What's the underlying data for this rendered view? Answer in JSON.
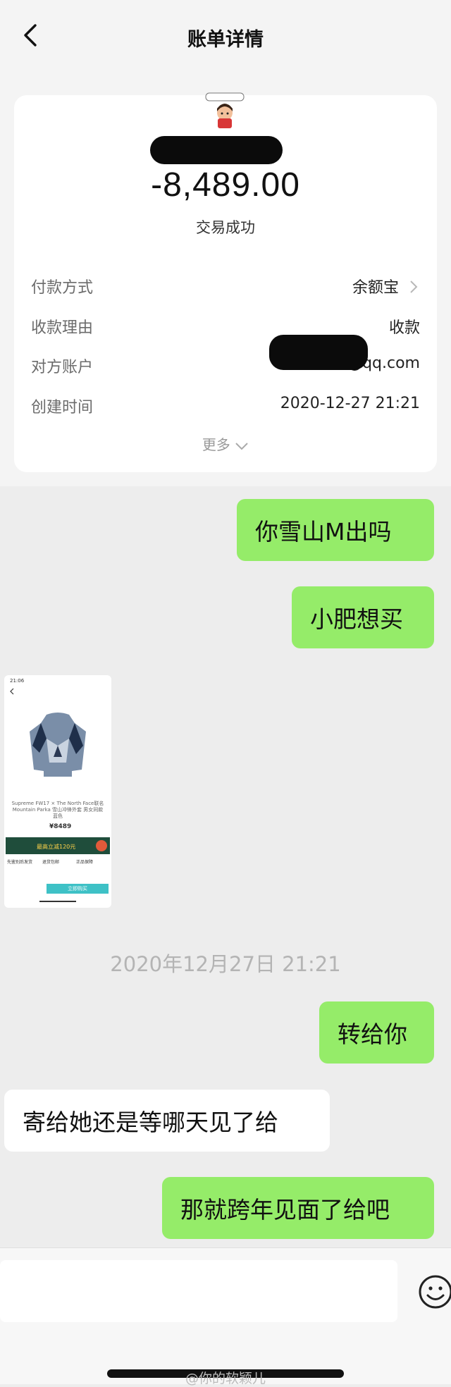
{
  "header": {
    "title": "账单详情",
    "back_icon": "chevron-left-icon"
  },
  "bill": {
    "amount": "-8,489.00",
    "status": "交易成功",
    "rows": [
      {
        "label": "付款方式",
        "value": "余额宝"
      },
      {
        "label": "收款理由",
        "value": "收款"
      },
      {
        "label": "对方账户",
        "value": "@qq.com"
      },
      {
        "label": "创建时间",
        "value": "2020-12-27 21:21"
      }
    ],
    "more": "更多"
  },
  "chat": {
    "messages": [
      {
        "side": "right",
        "text": "你雪山M出吗"
      },
      {
        "side": "right",
        "text": "小肥想买"
      },
      {
        "side": "right",
        "text": "转给你"
      },
      {
        "side": "left",
        "text": "寄给她还是等哪天见了给"
      },
      {
        "side": "right",
        "text": "那就跨年见面了给吧"
      }
    ],
    "timestamp": "2020年12月27日 21:21",
    "shared_screenshot": {
      "status_time": "21:06",
      "product_title": "Supreme FW17 × The North Face联名 Mountain Parka 雪山冲锋外套 男女同款 蓝色",
      "price": "¥8489",
      "banner": "最高立减120元",
      "buy_label": "立即购买",
      "tags": [
        "先鉴别后发货",
        "退货包邮",
        "正品保障"
      ]
    }
  },
  "footer": {
    "watermark": "@你的软颖儿",
    "emoji_icon": "smiley-icon"
  },
  "colors": {
    "bubble_green": "#95ec69",
    "background": "#ededed"
  }
}
